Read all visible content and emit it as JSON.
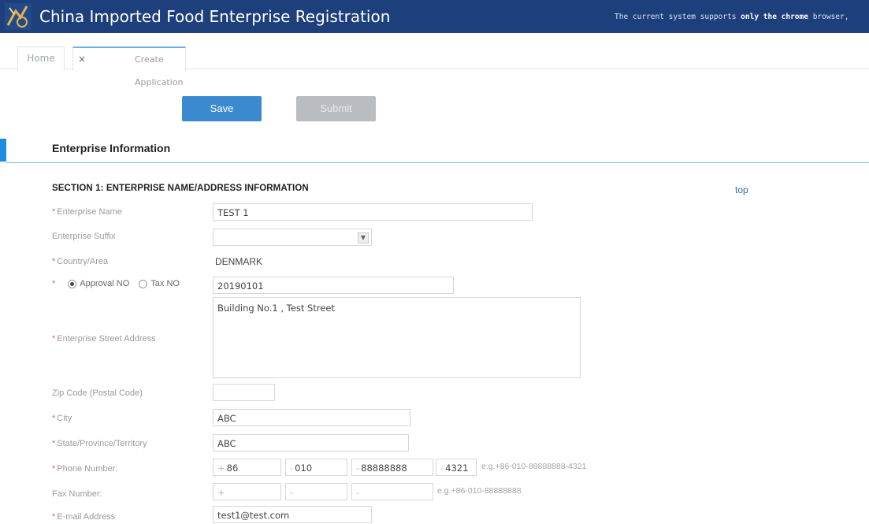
{
  "header": {
    "title": "China Imported Food Enterprise Registration",
    "notice_prefix": "The current system supports",
    "notice_bold": "only the chrome",
    "notice_suffix": "browser,",
    "logo_icon": "dragon-logo-icon"
  },
  "tabs": [
    {
      "label": "Home"
    },
    {
      "label": "Create Application",
      "close": "×"
    }
  ],
  "toolbar": {
    "save_label": "Save",
    "submit_label": "Submit"
  },
  "section": {
    "title": "Enterprise Information"
  },
  "subsection": {
    "title": "SECTION 1: ENTERPRISE NAME/ADDRESS INFORMATION",
    "top_link": "top"
  },
  "fields": {
    "enterprise_name": {
      "label": "Enterprise Name",
      "required": true,
      "value": "TEST 1"
    },
    "enterprise_suffix": {
      "label": "Enterprise Suffix",
      "required": false,
      "value": ""
    },
    "country": {
      "label": "Country/Area",
      "required": true,
      "value": "DENMARK"
    },
    "approval": {
      "option_a": "Approval NO",
      "option_b": "Tax NO",
      "selected": "Approval NO",
      "value": "20190101"
    },
    "street_address": {
      "label": "Enterprise Street Address",
      "required": true,
      "value": "Building No.1 , Test Street"
    },
    "zip": {
      "label": "Zip Code (Postal Code)",
      "required": false,
      "value": ""
    },
    "city": {
      "label": "City",
      "required": true,
      "value": "ABC"
    },
    "state": {
      "label": "State/Province/Territory",
      "required": true,
      "value": "ABC"
    },
    "phone": {
      "label": "Phone Number:",
      "required": true,
      "country": "86",
      "area": "010",
      "number": "88888888",
      "ext": "4321",
      "hint": "e.g.+86-010-88888888-4321"
    },
    "fax": {
      "label": "Fax Number:",
      "required": false,
      "country": "",
      "area": "",
      "number": "",
      "hint": "e.g.+86-010-88888888"
    },
    "email": {
      "label": "E-mail Address",
      "required": true,
      "value": "test1@test.com"
    }
  },
  "req_mark": "*",
  "plus": "+",
  "dash": "-"
}
